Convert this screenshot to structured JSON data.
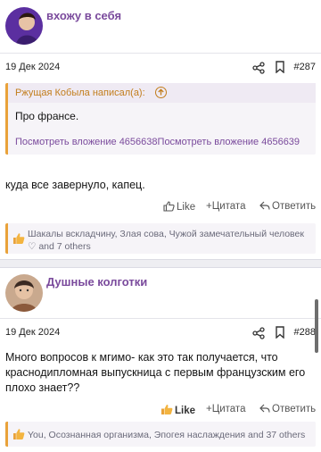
{
  "posts": [
    {
      "author": "вхожу в себя",
      "date": "19 Дек 2024",
      "number": "#287",
      "quote": {
        "author": "Ржущая Кобыла написал(а):",
        "text": "Про франсе.",
        "attachments": [
          "Посмотреть вложение 4656638",
          "Посмотреть вложение 4656639"
        ]
      },
      "text": "куда все завернуло, капец.",
      "actions": {
        "like": "Like",
        "quote": "+Цитата",
        "reply": "Ответить"
      },
      "reactions": "Шакалы вскладчину, Злая сова, Чужой замечательный человек ♡ and 7 others"
    },
    {
      "author": "Душные колготки",
      "date": "19 Дек 2024",
      "number": "#288",
      "text": "Много вопросов к мгимо- как это так получается, что краснодипломная выпускница с первым французским его плохо знает??",
      "actions": {
        "like": "Like",
        "quote": "+Цитата",
        "reply": "Ответить"
      },
      "reactions": "You, Осознанная организма, Эпогея наслаждения and 37 others"
    }
  ],
  "colors": {
    "accent": "#7a4a9c",
    "quote_border": "#e9a23a",
    "quote_author": "#c27d1c"
  },
  "icons": [
    "avatar-1",
    "avatar-2",
    "share-icon",
    "bookmark-icon",
    "arrow-up-icon",
    "thumbs-up-icon",
    "reply-arrow-icon",
    "reaction-thumb-icon"
  ]
}
